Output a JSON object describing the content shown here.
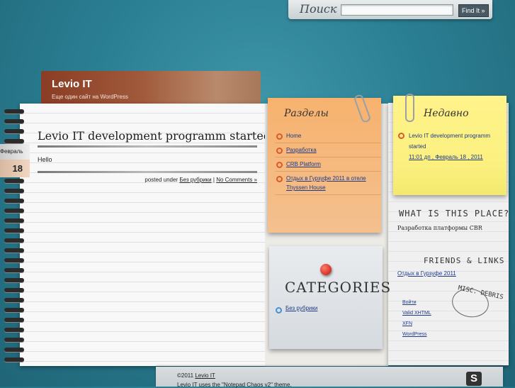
{
  "search": {
    "label": "Поиск",
    "button": "Find It »"
  },
  "site": {
    "title": "Levio IT",
    "description": "Еще один сайт на WordPress"
  },
  "post": {
    "title": "Levio IT development programm started",
    "body": "Hello",
    "meta_prefix": "posted under",
    "category": "Без рубрики",
    "separator": "|",
    "comments": "No Comments »",
    "date_month": "Февраль",
    "date_day": "18"
  },
  "pages": {
    "title": "Разделы",
    "items": [
      {
        "label": "Home",
        "underline": false
      },
      {
        "label": "Разработка",
        "underline": true
      },
      {
        "label": "CRB Platform",
        "underline": true
      },
      {
        "label": "Отдых в Гурзуфе 2011 в отеле Thyssen House",
        "underline": true
      }
    ]
  },
  "recent": {
    "title": "Недавно",
    "item": "Levio IT development programm started",
    "date": "11:01 дп , Февраль 18 , 2011"
  },
  "about": {
    "heading": "WHAT IS THIS PLACE?",
    "text": "Разработка платформы CBR"
  },
  "friends": {
    "heading": "FRIENDS & LINKS",
    "link": "Отдых в Гурзуфе 2011"
  },
  "misc": {
    "heading": "MISC. DEBRIS",
    "items": [
      "Войти",
      "Valid XHTML",
      "XFN",
      "WordPress"
    ]
  },
  "categories": {
    "title": "CATEGORIES",
    "item": "Без рубрики"
  },
  "footer": {
    "copyright": "©2011",
    "site_link": "Levio IT",
    "theme_text": "Levio IT uses the \"Notepad Chaos v2\" theme.",
    "logo": "S"
  },
  "colors": {
    "background": "#2b7f93",
    "link": "#1f3a86",
    "orange_note": "#f7b26e",
    "yellow_note": "#fbf07f",
    "header_tab": "#8a3d24"
  }
}
